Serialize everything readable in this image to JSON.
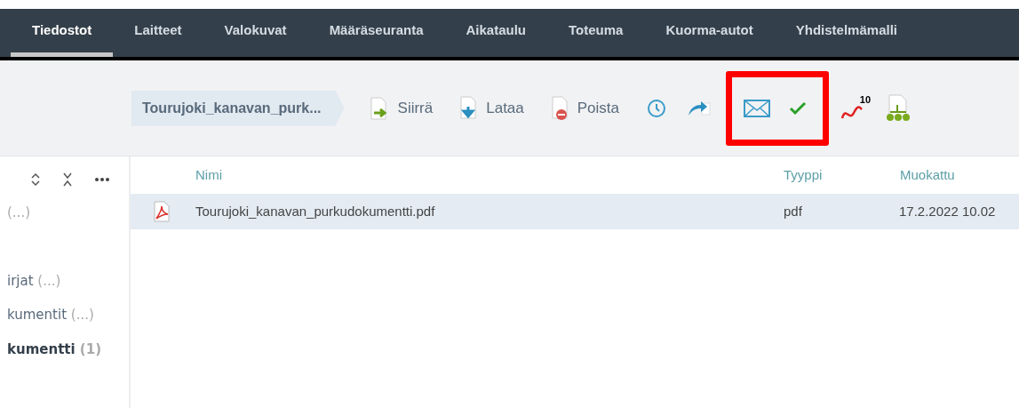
{
  "tabs": [
    {
      "label": "Tiedostot",
      "selected": true
    },
    {
      "label": "Laitteet",
      "selected": false
    },
    {
      "label": "Valokuvat",
      "selected": false
    },
    {
      "label": "Määräseuranta",
      "selected": false
    },
    {
      "label": "Aikataulu",
      "selected": false
    },
    {
      "label": "Toteuma",
      "selected": false
    },
    {
      "label": "Kuorma-autot",
      "selected": false
    },
    {
      "label": "Yhdistelmämalli",
      "selected": false
    }
  ],
  "breadcrumb": "Tourujoki_kanavan_purk...",
  "toolbar": {
    "actions": [
      {
        "kind": "move",
        "label": "Siirrä"
      },
      {
        "kind": "download",
        "label": "Lataa"
      },
      {
        "kind": "delete",
        "label": "Poista"
      }
    ],
    "icons": [
      {
        "kind": "clock"
      },
      {
        "kind": "share"
      },
      {
        "kind": "mail",
        "highlighted": true
      },
      {
        "kind": "check",
        "highlighted": true
      },
      {
        "kind": "curve",
        "text": "10"
      },
      {
        "kind": "tree"
      }
    ]
  },
  "sidebar": {
    "items": [
      {
        "count": "(...)",
        "bold": false
      },
      {
        "name": "irjat",
        "count": "(...)",
        "bold": false
      },
      {
        "name": "kumentit",
        "count": "(...)",
        "bold": false
      },
      {
        "name": "kumentti",
        "count": "(1)",
        "bold": true
      }
    ]
  },
  "table": {
    "columns": [
      "Nimi",
      "Tyyppi",
      "Muokattu"
    ],
    "rows": [
      {
        "name": "Tourujoki_kanavan_purkudokumentti.pdf",
        "type": "pdf",
        "modified": "17.2.2022 10.02",
        "selected": true
      }
    ]
  }
}
